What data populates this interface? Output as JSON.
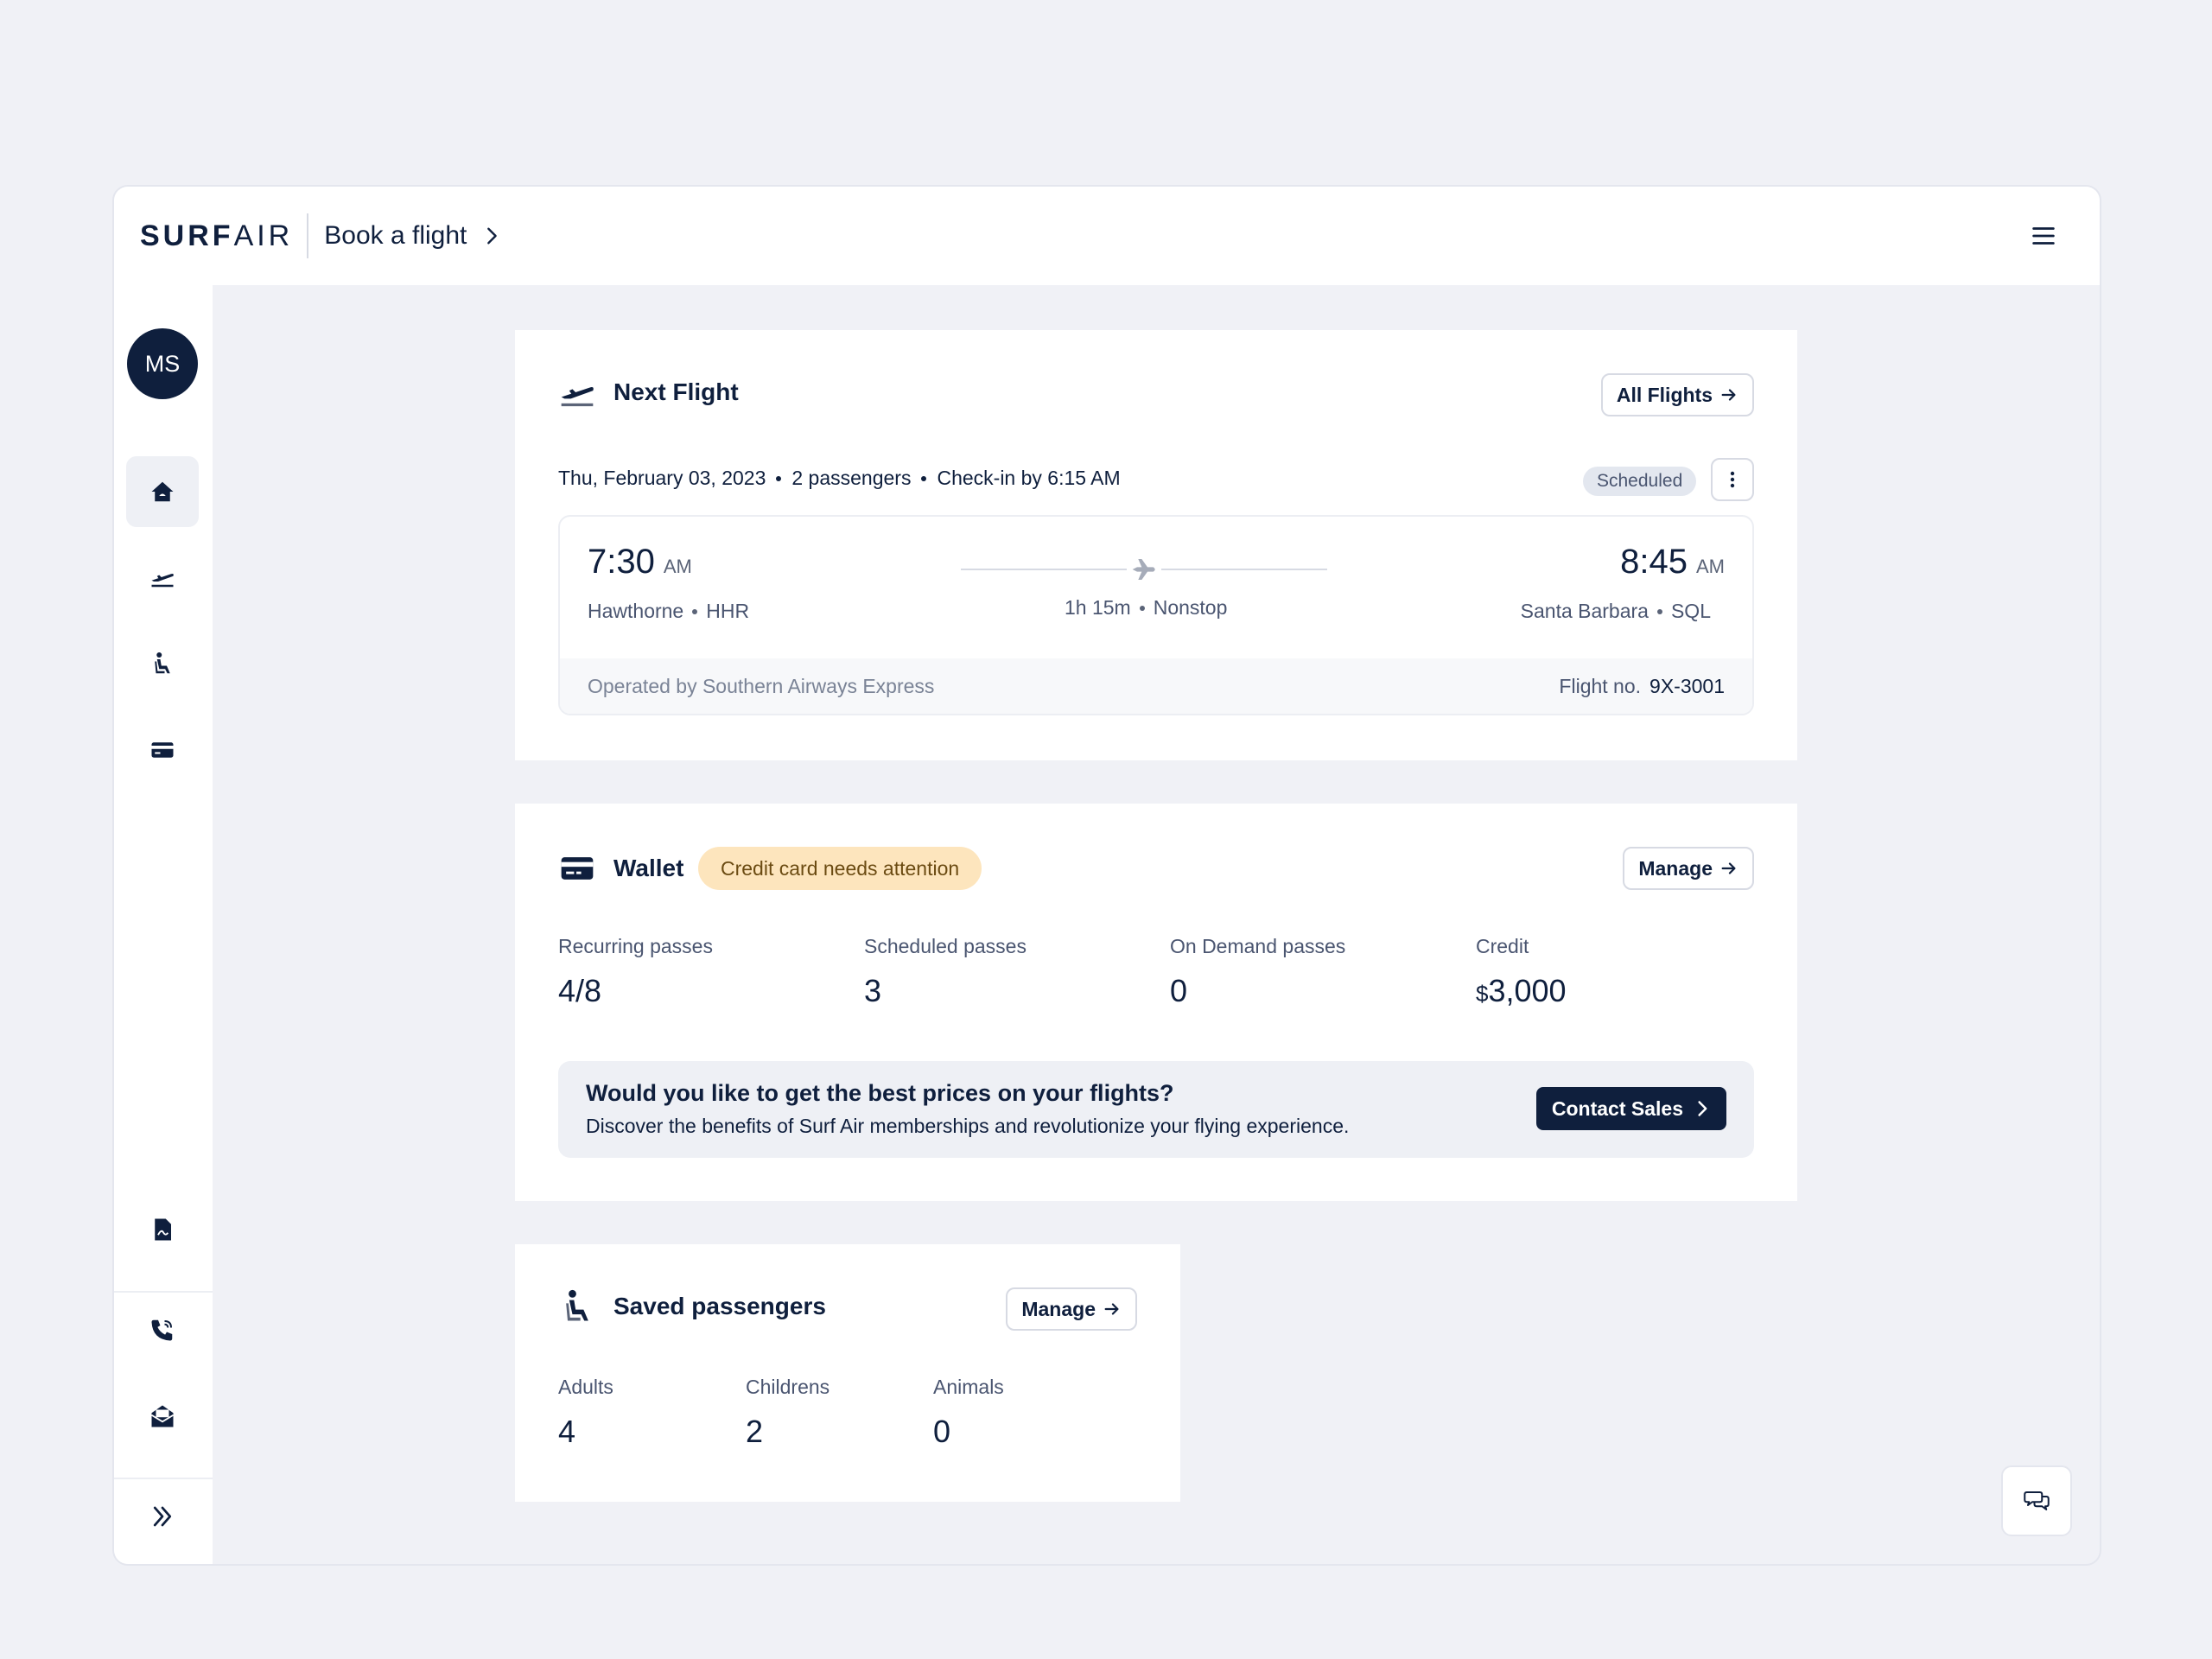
{
  "brand": {
    "surf": "SURF",
    "air": "AIR"
  },
  "header": {
    "book_label": "Book a flight"
  },
  "user": {
    "initials": "MS"
  },
  "next_flight": {
    "title": "Next Flight",
    "all_flights_label": "All Flights",
    "date": "Thu, February 03, 2023",
    "passengers": "2 passengers",
    "checkin": "Check-in by 6:15 AM",
    "status": "Scheduled",
    "departure": {
      "time": "7:30",
      "ampm": "AM",
      "city": "Hawthorne",
      "code": "HHR"
    },
    "arrival": {
      "time": "8:45",
      "ampm": "AM",
      "city": "Santa Barbara",
      "code": "SQL"
    },
    "duration": "1h 15m",
    "stops": "Nonstop",
    "operated_by": "Operated by Southern Airways Express",
    "flight_no_label": "Flight no.",
    "flight_no": "9X-3001"
  },
  "wallet": {
    "title": "Wallet",
    "alert": "Credit card needs attention",
    "manage_label": "Manage",
    "stats": [
      {
        "label": "Recurring passes",
        "value": "4/8"
      },
      {
        "label": "Scheduled passes",
        "value": "3"
      },
      {
        "label": "On Demand passes",
        "value": "0"
      },
      {
        "label": "Credit",
        "currency": "$",
        "value": "3,000"
      }
    ],
    "promo": {
      "title": "Would you like to get the best prices on your flights?",
      "subtitle": "Discover the benefits of Surf Air memberships and revolutionize your flying experience.",
      "cta": "Contact Sales"
    }
  },
  "passengers": {
    "title": "Saved passengers",
    "manage_label": "Manage",
    "stats": [
      {
        "label": "Adults",
        "value": "4"
      },
      {
        "label": "Childrens",
        "value": "2"
      },
      {
        "label": "Animals",
        "value": "0"
      }
    ]
  },
  "icons": {
    "nav": [
      "home-icon",
      "flight-takeoff-icon",
      "passenger-seat-icon",
      "credit-card-icon",
      "document-icon",
      "phone-icon",
      "mail-icon",
      "expand-icon"
    ],
    "chat": "chat-icon"
  },
  "colors": {
    "navy": "#0f1f3d",
    "attention": "#fde5bd",
    "background": "#f0f1f6"
  }
}
